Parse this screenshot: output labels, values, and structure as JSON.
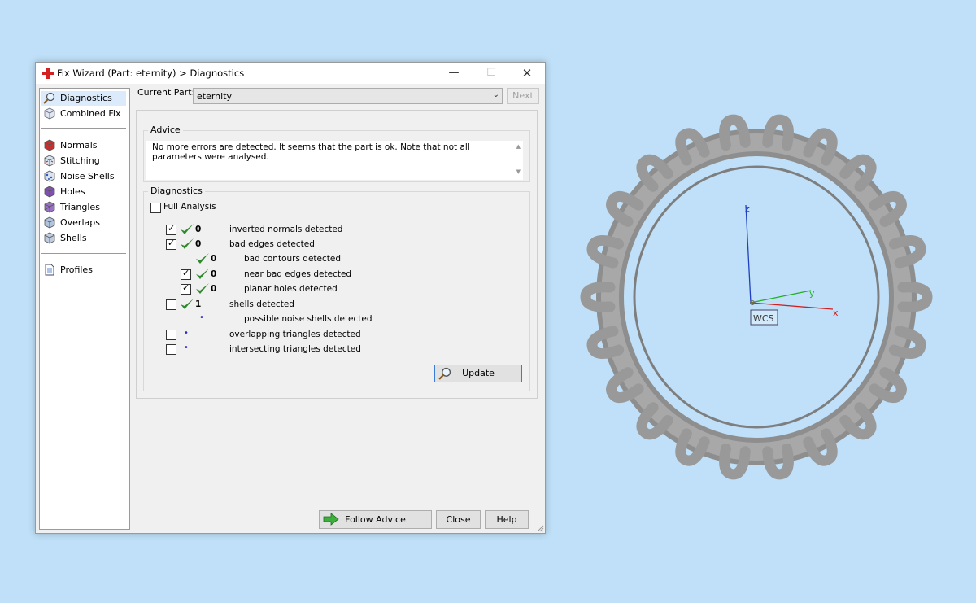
{
  "window": {
    "title": "Fix Wizard (Part: eternity) > Diagnostics",
    "min_glyph": "—",
    "max_glyph": "☐",
    "close_glyph": "✕",
    "app_icon": "red-cross-icon"
  },
  "sidebar": {
    "items": [
      {
        "label": "Diagnostics",
        "icon": "magnifier-icon",
        "selected": true
      },
      {
        "label": "Combined Fix",
        "icon": "cube-icon"
      },
      {
        "label": "Normals",
        "icon": "normals-cube-icon"
      },
      {
        "label": "Stitching",
        "icon": "stitching-cube-icon"
      },
      {
        "label": "Noise Shells",
        "icon": "noise-shells-icon"
      },
      {
        "label": "Holes",
        "icon": "holes-cube-icon"
      },
      {
        "label": "Triangles",
        "icon": "triangles-cube-icon"
      },
      {
        "label": "Overlaps",
        "icon": "overlaps-cube-icon"
      },
      {
        "label": "Shells",
        "icon": "shells-cube-icon"
      },
      {
        "label": "Profiles",
        "icon": "document-icon"
      }
    ]
  },
  "current_part": {
    "label": "Current Part:",
    "value": "eternity",
    "next_label": "Next"
  },
  "advice": {
    "title": "Advice",
    "text": "No more errors are detected. It seems that the part is ok. Note that not all parameters were analysed."
  },
  "diagnostics": {
    "title": "Diagnostics",
    "full_analysis_label": "Full Analysis",
    "rows": [
      {
        "label": "inverted normals detected",
        "count": "0",
        "checked": true
      },
      {
        "label": "bad edges detected",
        "count": "0",
        "checked": true
      },
      {
        "label": "bad contours detected",
        "count": "0"
      },
      {
        "label": "near bad edges detected",
        "count": "0",
        "checked": true
      },
      {
        "label": "planar holes detected",
        "count": "0",
        "checked": true
      },
      {
        "label": "shells detected",
        "count": "1",
        "checked": false
      },
      {
        "label": "possible noise shells detected",
        "count": "•"
      },
      {
        "label": "overlapping triangles detected",
        "count": "•",
        "checked": false
      },
      {
        "label": "intersecting triangles detected",
        "count": "•",
        "checked": false
      }
    ],
    "update_label": "Update"
  },
  "buttons": {
    "follow_advice": "Follow Advice",
    "close": "Close",
    "help": "Help"
  },
  "viewport": {
    "axis_x": "x",
    "axis_y": "y",
    "axis_z": "z",
    "wcs_label": "WCS",
    "colors": {
      "x": "#d02020",
      "y": "#22b022",
      "z": "#2040c0",
      "model": "#9a9a9a"
    }
  },
  "colors": {
    "background": "#bfe0f8",
    "check_green": "#2f8a2f",
    "selection": "#dcebfc"
  }
}
